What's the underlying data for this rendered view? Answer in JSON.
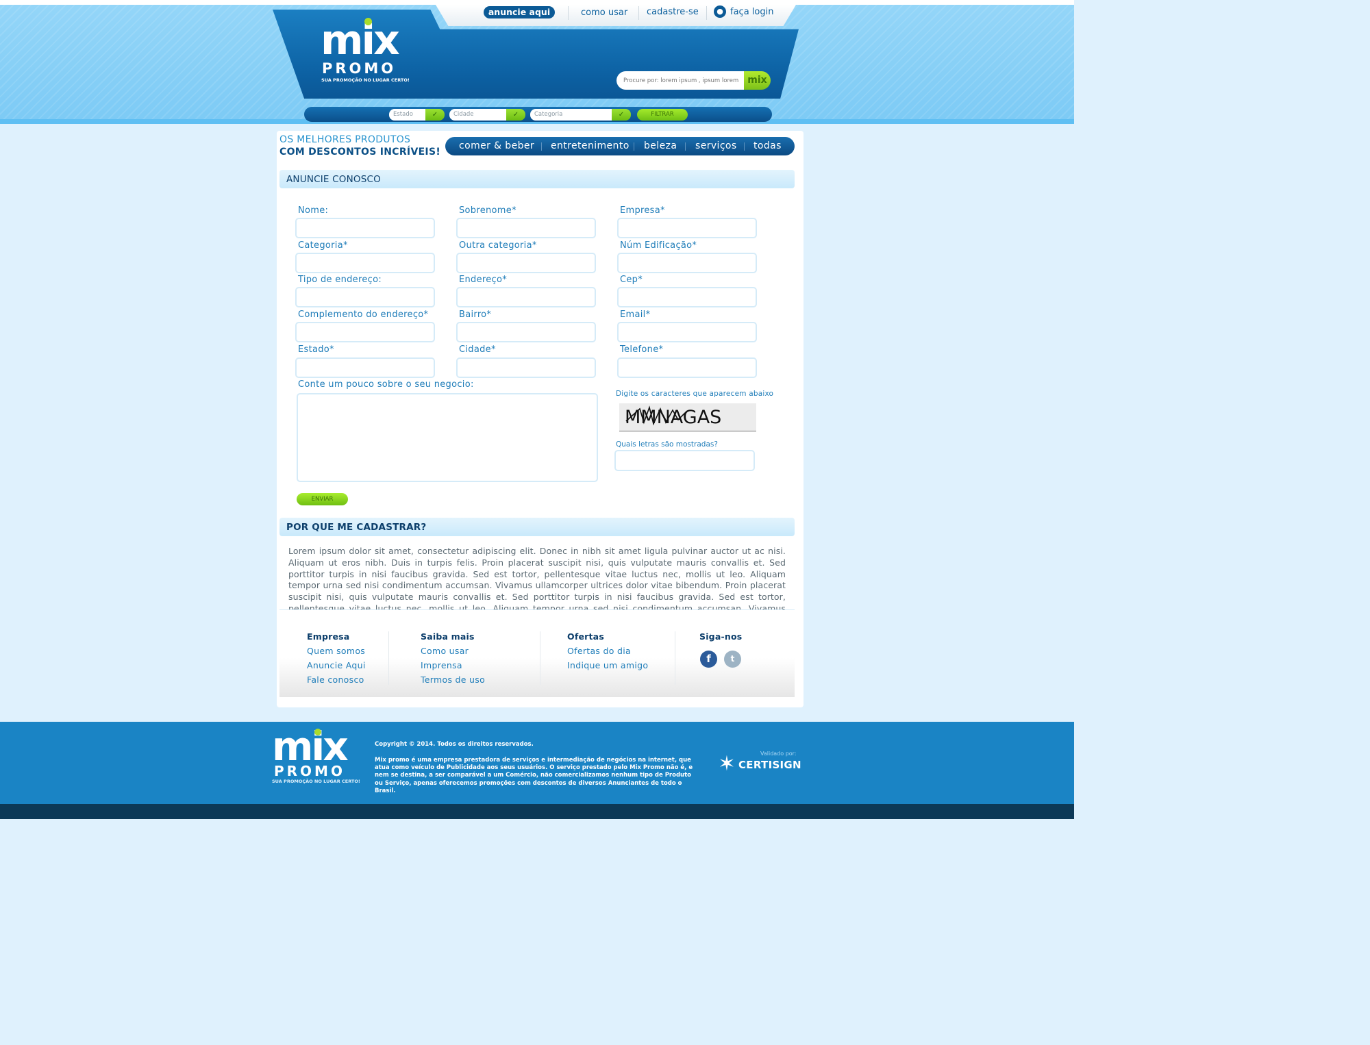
{
  "header": {
    "nav": {
      "anuncie": "anuncie aqui",
      "como_usar": "como usar",
      "cadastre": "cadastre-se",
      "login": "faça login"
    },
    "logo": {
      "word1": "mix",
      "word2": "PROMO",
      "tagline": "SUA PROMOÇÃO NO LUGAR CERTO!"
    },
    "search": {
      "placeholder": "Procure por: lorem ipsum , ipsum lorem",
      "button": "mix"
    },
    "filters": {
      "estado": "Estado",
      "cidade": "Cidade",
      "categoria": "Categoria",
      "button": "FILTRAR"
    }
  },
  "tagline": {
    "line1": "OS MELHORES PRODUTOS",
    "line2": "COM DESCONTOS INCRÍVEIS!"
  },
  "categories": [
    "comer & beber",
    "entretenimento",
    "beleza",
    "serviços",
    "todas"
  ],
  "form": {
    "title": "ANUNCIE CONOSCO",
    "fields": [
      [
        "Nome:",
        "Sobrenome*",
        "Empresa*"
      ],
      [
        "Categoria*",
        "Outra categoria*",
        "Núm Edificação*"
      ],
      [
        "Tipo de endereço:",
        "Endereço*",
        "Cep*"
      ],
      [
        "Complemento do endereço*",
        "Bairro*",
        "Email*"
      ],
      [
        "Estado*",
        "Cidade*",
        "Telefone*"
      ]
    ],
    "about_label": "Conte um pouco sobre o seu negocio:",
    "captcha_label": "Digite os caracteres  que aparecem abaixo",
    "captcha_text": "MMNAGAS",
    "captcha_question": "Quais letras são mostradas?",
    "submit": "ENVIAR"
  },
  "why": {
    "title": "POR QUE ME CADASTRAR?",
    "text": "Lorem ipsum dolor sit amet, consectetur adipiscing elit. Donec in nibh sit amet ligula pulvinar auctor ut ac nisi. Aliquam ut eros nibh. Duis in turpis felis. Proin placerat suscipit nisi, quis vulputate mauris convallis et. Sed porttitor turpis in nisi faucibus gravida. Sed est tortor, pellentesque vitae luctus nec, mollis ut leo. Aliquam tempor urna sed nisi condimentum accumsan. Vivamus ullamcorper ultrices dolor vitae bibendum. Proin placerat suscipit nisi, quis vulputate mauris convallis et. Sed porttitor turpis in nisi faucibus gravida. Sed est tortor, pellentesque vitae luctus nec, mollis ut leo. Aliquam tempor urna sed nisi condimentum accumsan. Vivamus ullamcorper ultrices dolor vitae bibendum."
  },
  "footer_links": {
    "empresa": {
      "title": "Empresa",
      "links": [
        "Quem somos",
        "Anuncie Aqui",
        "Fale conosco"
      ]
    },
    "saiba": {
      "title": "Saiba mais",
      "links": [
        "Como usar",
        "Imprensa",
        "Termos de uso"
      ]
    },
    "ofertas": {
      "title": "Ofertas",
      "links": [
        "Ofertas do dia",
        "Indique um amigo"
      ]
    },
    "siga": {
      "title": "Siga-nos",
      "icons": [
        "facebook-icon",
        "twitter-icon"
      ]
    }
  },
  "bottom": {
    "copyright": "Copyright © 2014. Todos os direitos reservados.",
    "about": "Mix promo é uma empresa prestadora de serviços e intermediação de negócios na internet, que atua como veículo de Publicidade aos seus usuários. O serviço prestado pelo Mix Promo não é, e nem se destina, a ser comparável a um Comércio, não comercializamos nenhum tipo de Produto ou Serviço, apenas oferecemos promoções com descontos de diversos Anunciantes de todo o Brasil.",
    "validado": "Validado por:",
    "certisign": "CERTISIGN"
  },
  "colors": {
    "brand_blue": "#0b5a96",
    "accent_green": "#7dc11a",
    "link_blue": "#1f7db9",
    "footer_blue": "#1a84c5"
  }
}
